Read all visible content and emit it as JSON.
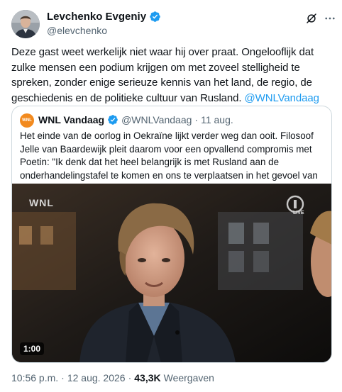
{
  "author": {
    "display_name": "Levchenko Evgeniy",
    "handle": "@elevchenko",
    "verified_icon": "verified-badge-icon",
    "badge_color": "#1d9bf0"
  },
  "tweet": {
    "text": "Deze gast weet werkelijk niet waar hij over praat. Ongelooflijk dat zulke mensen een podium krijgen om met zoveel stelligheid te spreken, zonder enige serieuze kennis van het land, de regio, de geschiedenis en de politieke cultuur van Rusland. ",
    "mention": "@WNLVandaag",
    "mention_color": "#1d9bf0"
  },
  "quote": {
    "avatar_label": "WNL",
    "display_name": "WNL Vandaag",
    "handle": "@WNLVandaag",
    "separator": "·",
    "date": "11 aug.",
    "text": "Het einde van de oorlog in Oekraïne lijkt verder weg dan ooit. Filosoof Jelle van Baardewijk pleit daarom voor een opvallend compromis met Poetin: \"Ik denk dat het heel belangrijk is met Rusland aan de onderhandelingstafel te komen en ons te verplaatsen in het gevoel van",
    "video": {
      "watermark": "WNL",
      "channel_label": "LIVE",
      "duration": "1:00"
    }
  },
  "meta": {
    "time": "10:56 p.m.",
    "separator": "·",
    "date": "12 aug. 2026",
    "separator2": "·",
    "views_count": "43,3K",
    "views_label": "Weergaven"
  }
}
